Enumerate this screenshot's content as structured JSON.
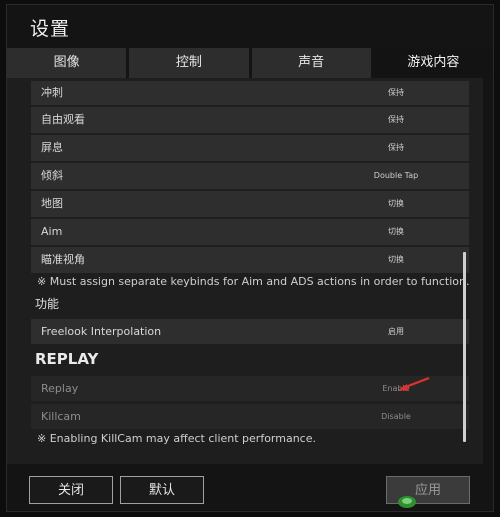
{
  "window": {
    "title": "设置"
  },
  "tabs": [
    {
      "label": "图像"
    },
    {
      "label": "控制"
    },
    {
      "label": "声音"
    },
    {
      "label": "游戏内容"
    }
  ],
  "rows": [
    {
      "label": "冲刺",
      "value": "保持"
    },
    {
      "label": "自由观看",
      "value": "保持"
    },
    {
      "label": "屏息",
      "value": "保持"
    },
    {
      "label": "倾斜",
      "value": "Double Tap"
    },
    {
      "label": "地图",
      "value": "切换"
    },
    {
      "label": "Aim",
      "value": "切换"
    },
    {
      "label": "瞄准视角",
      "value": "切换"
    }
  ],
  "note_aim": "※ Must assign separate keybinds for Aim and ADS actions in order to function.",
  "section_function": "功能",
  "freelook": {
    "label": "Freelook Interpolation",
    "value": "启用"
  },
  "section_replay": "REPLAY",
  "replay": {
    "label": "Replay",
    "value": "Enable"
  },
  "killcam": {
    "label": "Killcam",
    "value": "Disable"
  },
  "note_killcam": "※ Enabling KillCam may affect client performance.",
  "buttons": {
    "close": "关闭",
    "default": "默认",
    "apply": "应用"
  },
  "colors": {
    "active_tab": "#131313",
    "tab": "#2d2d2d",
    "arrow": "#e03030"
  }
}
